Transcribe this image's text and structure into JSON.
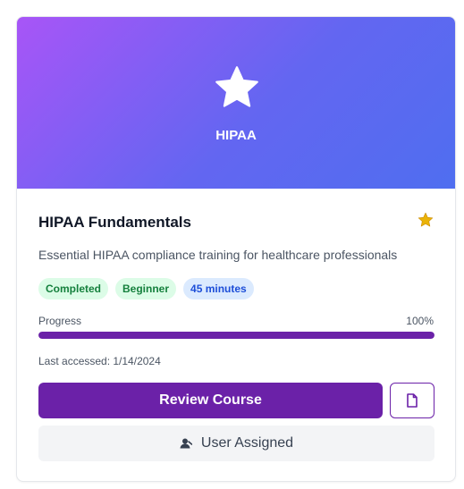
{
  "course": {
    "banner_label": "HIPAA",
    "banner_icon": "star-icon",
    "title": "HIPAA Fundamentals",
    "favorite_icon": "star-icon",
    "description": "Essential HIPAA compliance training for healthcare professionals",
    "badges": {
      "status": "Completed",
      "level": "Beginner",
      "duration": "45 minutes"
    },
    "progress": {
      "label": "Progress",
      "value_text": "100%",
      "value": 100
    },
    "last_accessed": "Last accessed: 1/14/2024",
    "actions": {
      "review_label": "Review Course",
      "document_icon": "document-icon",
      "assigned_label": "User Assigned",
      "assigned_icon": "user-icon"
    }
  },
  "colors": {
    "primary": "#6b21a8",
    "gradient_start": "#a855f7",
    "gradient_end": "#4f6ef0",
    "favorite_star": "#eab308",
    "badge_green_bg": "#dcfce7",
    "badge_green_text": "#15803d",
    "badge_blue_bg": "#dbeafe",
    "badge_blue_text": "#1d4ed8"
  }
}
